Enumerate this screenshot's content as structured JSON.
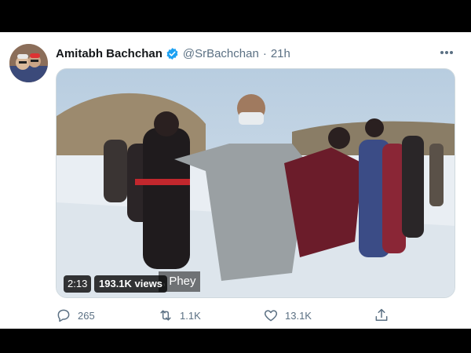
{
  "tweet": {
    "author_name": "Amitabh Bachchan",
    "handle": "@SrBachchan",
    "separator": "·",
    "time": "21h",
    "more_icon": "more-horizontal-icon",
    "verified_icon": "verified-badge-icon"
  },
  "video": {
    "duration": "2:13",
    "views": "193.1K views",
    "caption": ", Phey"
  },
  "actions": {
    "reply_count": "265",
    "retweet_count": "1.1K",
    "like_count": "13.1K",
    "reply_icon": "reply-icon",
    "retweet_icon": "retweet-icon",
    "like_icon": "heart-icon",
    "share_icon": "share-icon"
  },
  "colors": {
    "name": "#14171a",
    "secondary": "#5b7083",
    "verified": "#1da1f2",
    "frame_border": "#000000"
  }
}
